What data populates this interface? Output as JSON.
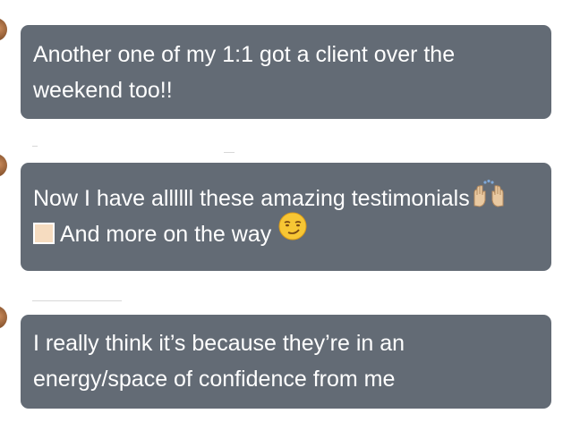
{
  "messages": [
    {
      "lines": [
        "Another one of my 1:1 got a client over the",
        "weekend too!!"
      ]
    },
    {
      "lines": [
        "Now I have allllll these amazing testimonials",
        "And more on the way"
      ],
      "emojis": [
        "raising-hands-icon",
        "skin-tone-square-icon",
        "smirking-face-icon"
      ]
    },
    {
      "lines": [
        "I really think it’s because they’re in an",
        "energy/space of confidence from me"
      ]
    }
  ],
  "colors": {
    "bubble": "#636b75",
    "text": "#ffffff",
    "background": "#ffffff"
  }
}
